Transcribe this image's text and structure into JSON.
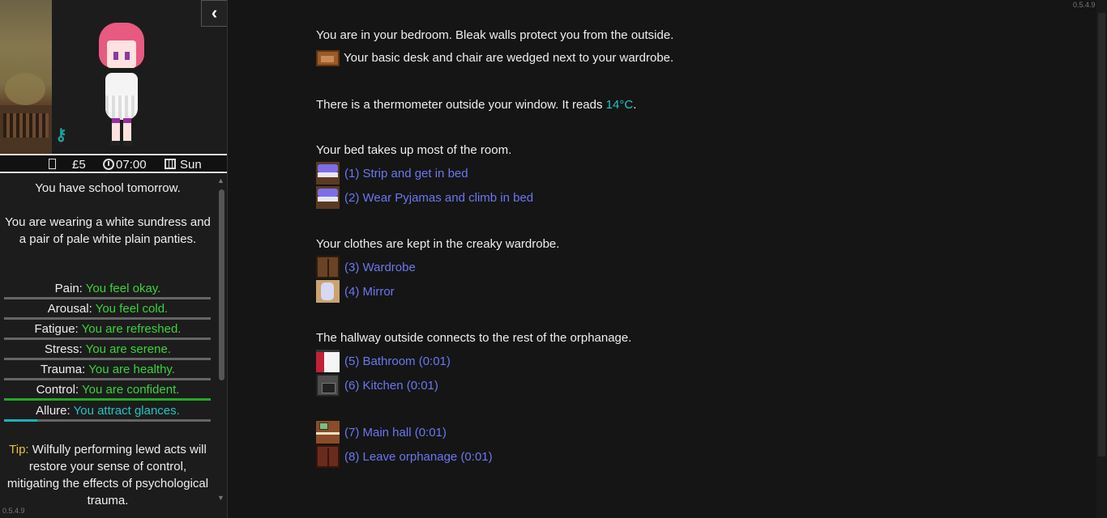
{
  "version": "0.5.4.9",
  "sidebar": {
    "collapse_icon": "chevron-left-icon",
    "status": {
      "money": "£5",
      "time": "07:00",
      "day": "Sun"
    },
    "school_note": "You have school tomorrow.",
    "clothing_note": "You are wearing a white sundress and a pair of pale white plain panties.",
    "stats": [
      {
        "label": "Pain:",
        "value": "You feel okay.",
        "level": 0.0
      },
      {
        "label": "Arousal:",
        "value": "You feel cold.",
        "level": 0.0
      },
      {
        "label": "Fatigue:",
        "value": "You are refreshed.",
        "level": 0.0
      },
      {
        "label": "Stress:",
        "value": "You are serene.",
        "level": 0.0
      },
      {
        "label": "Trauma:",
        "value": "You are healthy.",
        "level": 0.0
      },
      {
        "label": "Control:",
        "value": "You are confident.",
        "level": 1.0
      },
      {
        "label": "Allure:",
        "value": "You attract glances.",
        "level": 0.16
      }
    ],
    "tip_label": "Tip:",
    "tip_text": " Wilfully performing lewd acts will restore your sense of control, mitigating the effects of psychological trauma."
  },
  "main": {
    "intro": "You are in your bedroom. Bleak walls protect you from the outside.",
    "desk": "Your basic desk and chair are wedged next to your wardrobe.",
    "thermo_prefix": "There is a thermometer outside your window. It reads ",
    "thermo_value": "14°C",
    "thermo_suffix": ".",
    "bed_desc": "Your bed takes up most of the room.",
    "clothes_desc": "Your clothes are kept in the creaky wardrobe.",
    "hallway_desc": "The hallway outside connects to the rest of the orphanage.",
    "links": {
      "strip": "(1) Strip and get in bed",
      "pyjamas": "(2) Wear Pyjamas and climb in bed",
      "wardrobe": "(3) Wardrobe",
      "mirror": "(4) Mirror",
      "bathroom": "(5) Bathroom (0:01)",
      "kitchen": "(6) Kitchen (0:01)",
      "mainhall": "(7) Main hall (0:01)",
      "leave": "(8) Leave orphanage (0:01)"
    }
  },
  "colors": {
    "link": "#6b77f0",
    "good": "#3bd13b",
    "teal": "#20c4c4",
    "tip": "#e8c23b"
  }
}
